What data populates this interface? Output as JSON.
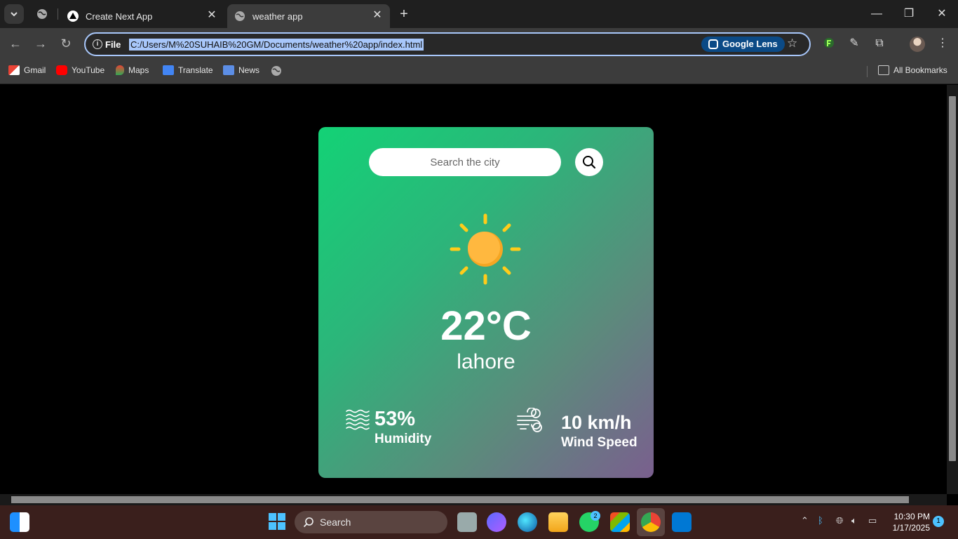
{
  "browser": {
    "tabs": [
      {
        "title": "Create Next App",
        "icon": "triangle-icon",
        "active": false
      },
      {
        "title": "weather app",
        "icon": "globe-icon",
        "active": true
      }
    ],
    "address_scheme": "File",
    "url": "C:/Users/M%20SUHAIB%20GM/Documents/weather%20app/index.html",
    "lens_label": "Google Lens",
    "bookmarks": [
      "Gmail",
      "YouTube",
      "Maps",
      "Translate",
      "News"
    ],
    "all_bookmarks_label": "All Bookmarks"
  },
  "app": {
    "search_placeholder": "Search the city",
    "temperature": "22°C",
    "city": "lahore",
    "humidity_value": "53%",
    "humidity_label": "Humidity",
    "wind_value": "10 km/h",
    "wind_label": "Wind Speed",
    "weather_icon": "sun-icon",
    "gradient_colors": [
      "#13d276",
      "#7a5f8e"
    ]
  },
  "taskbar": {
    "search_label": "Search",
    "whatsapp_badge": "2",
    "time": "10:30 PM",
    "date": "1/17/2025",
    "notification_count": "1"
  }
}
